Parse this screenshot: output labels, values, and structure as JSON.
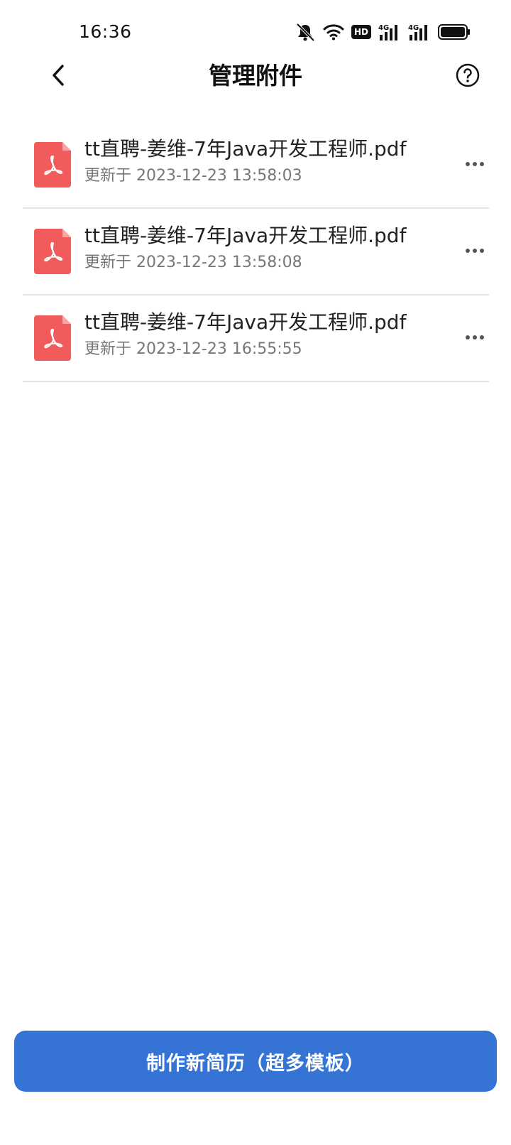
{
  "status_bar": {
    "time": "16:36",
    "hd_label": "HD",
    "network_1": "4G",
    "network_2": "4G"
  },
  "header": {
    "title": "管理附件"
  },
  "files": [
    {
      "name": "tt直聘-姜维-7年Java开发工程师.pdf",
      "updated": "更新于 2023-12-23 13:58:03",
      "icon": "pdf-icon"
    },
    {
      "name": "tt直聘-姜维-7年Java开发工程师.pdf",
      "updated": "更新于 2023-12-23 13:58:08",
      "icon": "pdf-icon"
    },
    {
      "name": "tt直聘-姜维-7年Java开发工程师.pdf",
      "updated": "更新于 2023-12-23 16:55:55",
      "icon": "pdf-icon"
    }
  ],
  "footer": {
    "create_label": "制作新简历（超多模板）"
  },
  "colors": {
    "accent": "#3574d4",
    "pdf_red": "#f15b5b",
    "divider": "#e4e4e4"
  }
}
